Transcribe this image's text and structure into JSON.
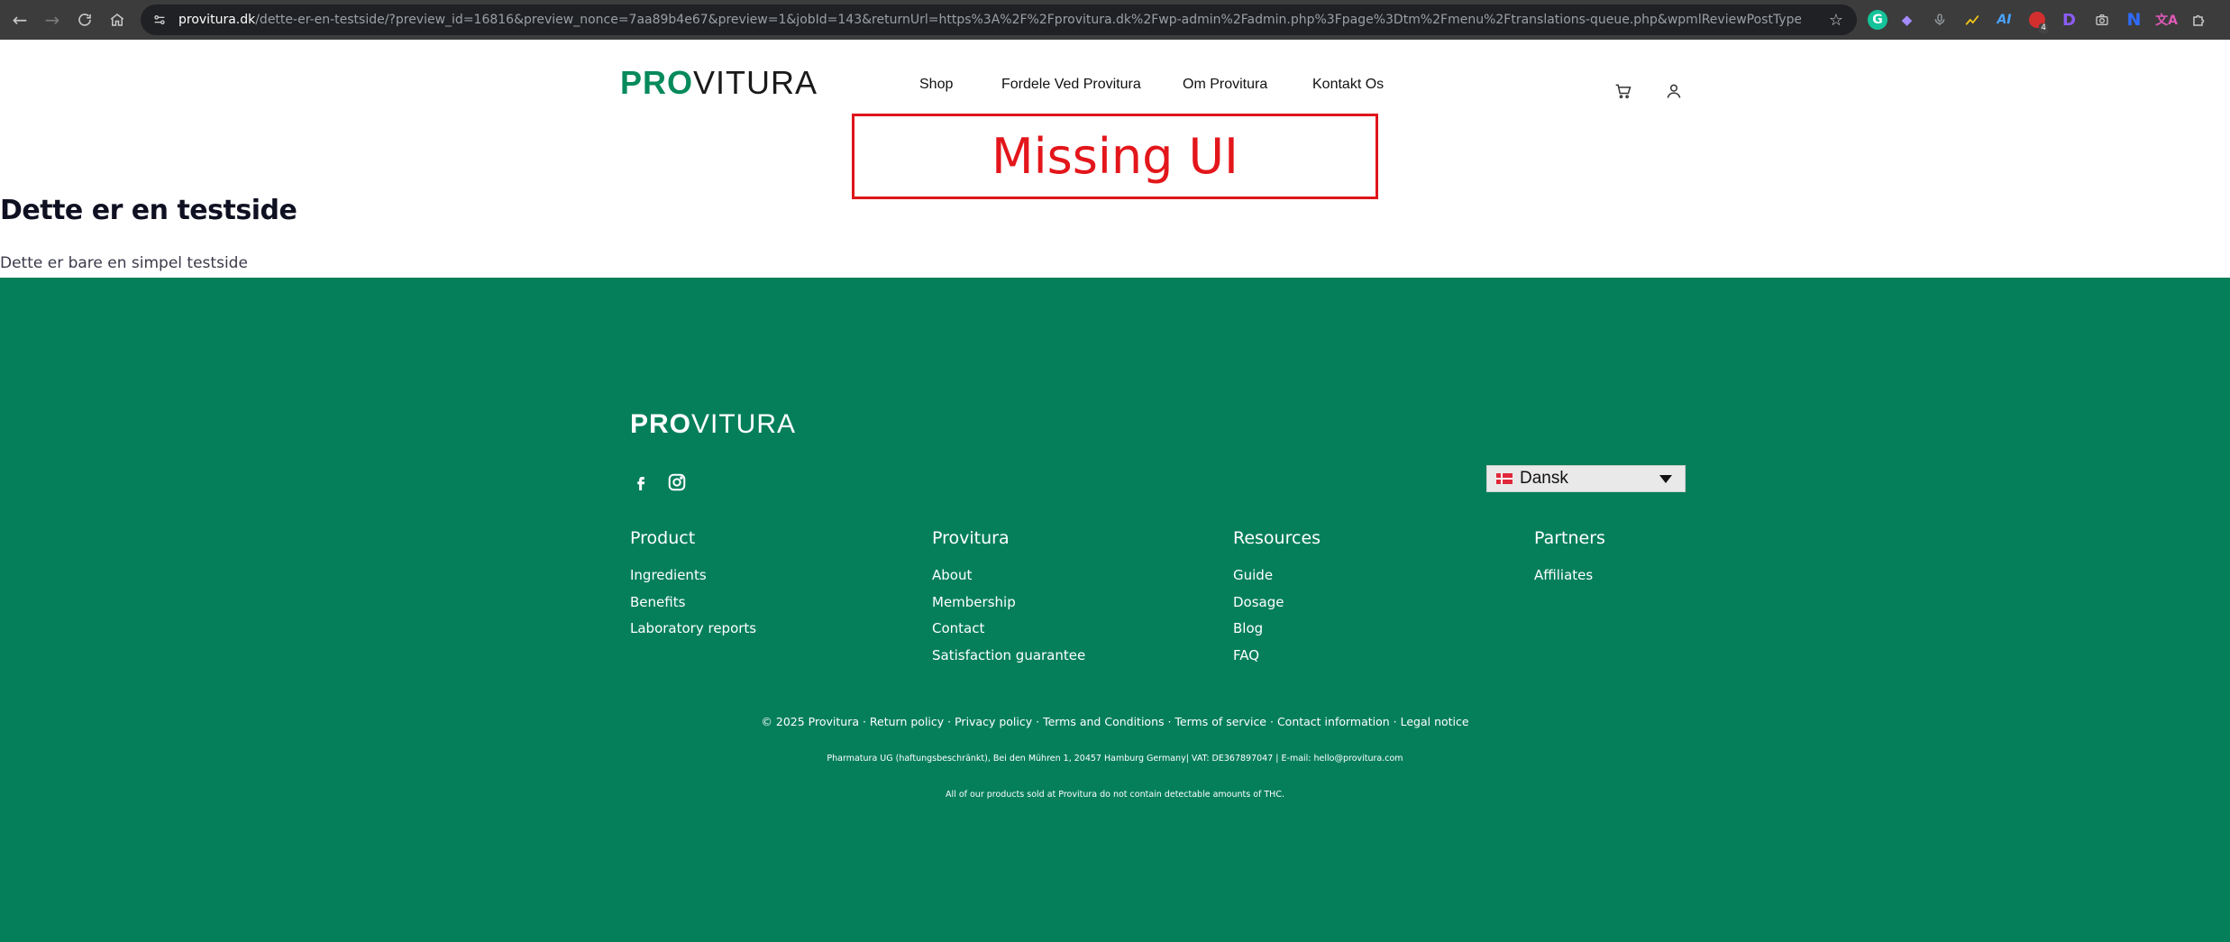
{
  "browser": {
    "url_host": "provitura.dk",
    "url_path": "/dette-er-en-testside/?preview_id=16816&preview_nonce=7aa89b4e67&preview=1&jobId=143&returnUrl=https%3A%2F%2Fprovitura.dk%2Fwp-admin%2Fadmin.php%3Fpage%3Dtm%2Fmenu%2Ftranslations-queue.php&wpmlReviewPostType=page",
    "extension_d_label": "D",
    "extension_n_label": "N",
    "extension_badge": "4"
  },
  "header": {
    "logo_pro": "PRO",
    "logo_vitura": "VITURA",
    "nav": [
      "Shop",
      "Fordele Ved Provitura",
      "Om Provitura",
      "Kontakt Os"
    ]
  },
  "placeholder": {
    "label": "Missing UI"
  },
  "page": {
    "title": "Dette er en testside",
    "body": "Dette er bare en simpel testside"
  },
  "footer": {
    "logo_pro": "PRO",
    "logo_vitura": "VITURA",
    "language": "Dansk",
    "columns": [
      {
        "heading": "Product",
        "links": [
          "Ingredients",
          "Benefits",
          "Laboratory reports"
        ]
      },
      {
        "heading": "Provitura",
        "links": [
          "About",
          "Membership",
          "Contact",
          "Satisfaction guarantee"
        ]
      },
      {
        "heading": "Resources",
        "links": [
          "Guide",
          "Dosage",
          "Blog",
          "FAQ"
        ]
      },
      {
        "heading": "Partners",
        "links": [
          "Affiliates"
        ]
      }
    ],
    "copyright": "© 2025 Provitura",
    "legal_links": [
      "Return policy",
      "Privacy policy",
      "Terms and Conditions",
      "Terms of service",
      "Contact information",
      "Legal notice"
    ],
    "separator": " · ",
    "company_info": "Pharmatura UG (haftungsbeschränkt), Bei den Mühren 1, 20457 Hamburg Germany| VAT: DE367897047 | E-mail: hello@provitura.com",
    "thc_notice": "All of our products sold at Provitura do not contain detectable amounts of THC."
  },
  "colors": {
    "brand_green": "#057f5a",
    "missing_ui_red": "#e3161b"
  }
}
